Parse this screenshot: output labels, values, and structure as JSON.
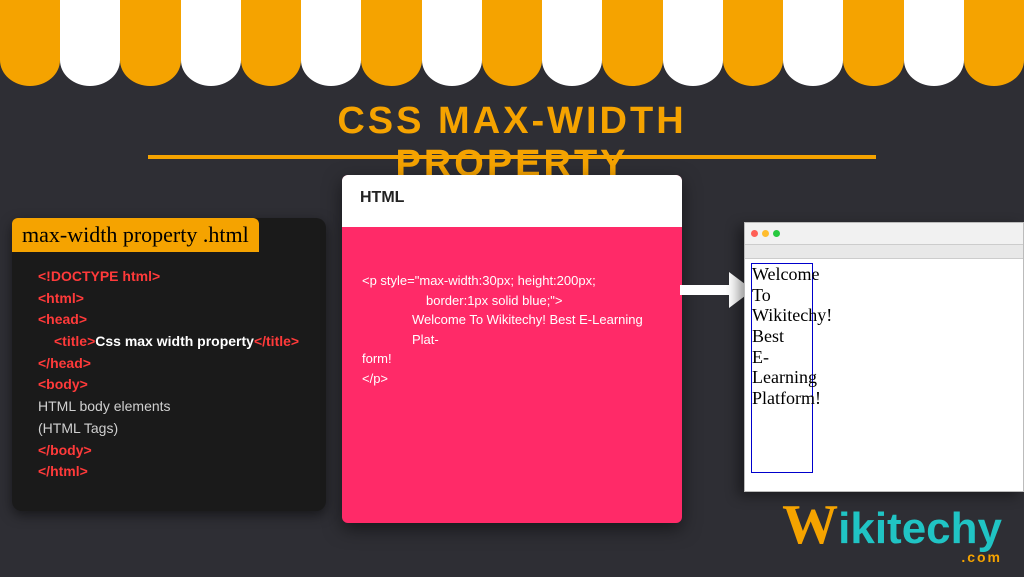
{
  "title": "CSS MAX-WIDTH PROPERTY",
  "code_panel": {
    "filename": "max-width property .html",
    "lines": {
      "l1": "<!DOCTYPE html>",
      "l2": "<html>",
      "l3": "<head>",
      "l4_open": "<title>",
      "l4_text": "Css max width property",
      "l4_close": "</title>",
      "l5": "</head>",
      "l6": "<body>",
      "l7a": "HTML body elements",
      "l7b": "(HTML Tags)",
      "l8": "</body>",
      "l9": "</html>"
    }
  },
  "html_card": {
    "header": "HTML",
    "snippet": {
      "s1": "<p style=\"max-width:30px; height:200px;",
      "s2": "border:1px solid blue;\">",
      "s3": "Welcome To Wikitechy! Best E-Learning Plat-",
      "s4": "form!",
      "s5": "</p>"
    }
  },
  "browser_output": {
    "lines": [
      "Welcome",
      "To",
      "Wikitechy!",
      "Best",
      "E-",
      "Learning",
      "Platform!"
    ]
  },
  "logo": {
    "text": "ikitechy",
    "w": "W",
    "com": ".com"
  }
}
